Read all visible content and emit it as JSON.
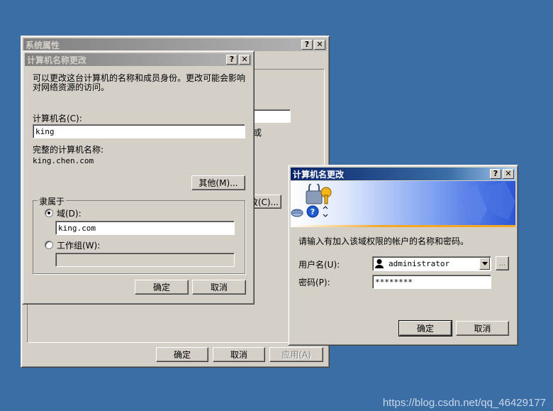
{
  "system_properties": {
    "title": "系统属性",
    "help_glyph": "?",
    "close_glyph": "✕",
    "ok_label": "确定",
    "cancel_label": "取消",
    "apply_label": "应用(A)",
    "partial_text_domain": "或",
    "partial_change_button": "改(C)..."
  },
  "computer_name_dialog": {
    "title": "计算机名称更改",
    "help_glyph": "?",
    "close_glyph": "✕",
    "description": "可以更改这台计算机的名称和成员身份。更改可能会影响对网络资源的访问。",
    "computer_name_label": "计算机名(C):",
    "computer_name_value": "king",
    "full_name_label": "完整的计算机名称:",
    "full_name_value": "king.chen.com",
    "more_button": "其他(M)...",
    "member_of_label": "隶属于",
    "domain_radio_label": "域(D):",
    "domain_value": "king.com",
    "workgroup_radio_label": "工作组(W):",
    "workgroup_value": "",
    "ok_label": "确定",
    "cancel_label": "取消"
  },
  "credentials_dialog": {
    "title": "计算机名更改",
    "help_glyph": "?",
    "close_glyph": "✕",
    "prompt": "请输入有加入该域权限的帐户的名称和密码。",
    "username_label": "用户名(U):",
    "username_value": "administrator",
    "browse_button": "...",
    "password_label": "密码(P):",
    "password_value": "********",
    "ok_label": "确定",
    "cancel_label": "取消"
  },
  "watermark": "https://blog.csdn.net/qq_46429177",
  "colors": {
    "desktop": "#3a6ea5",
    "title_active": "#0a246a",
    "title_inactive": "#808080",
    "window_face": "#d4d0c8"
  }
}
